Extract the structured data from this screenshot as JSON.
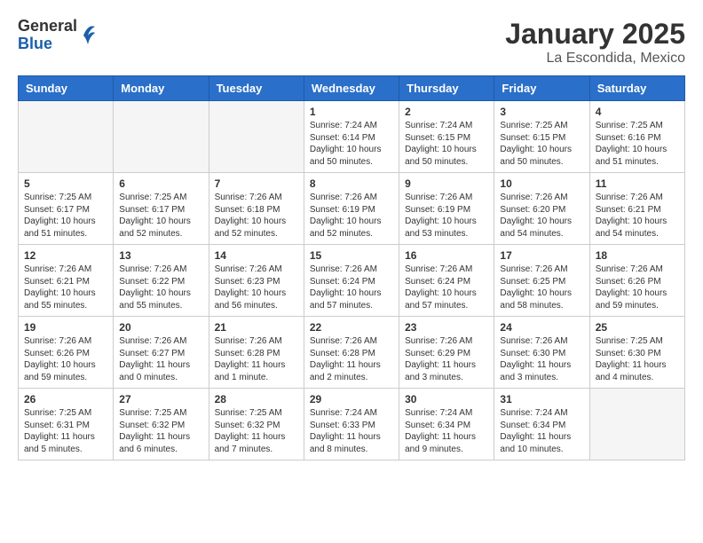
{
  "header": {
    "logo": {
      "general": "General",
      "blue": "Blue"
    },
    "title": "January 2025",
    "subtitle": "La Escondida, Mexico"
  },
  "weekdays": [
    "Sunday",
    "Monday",
    "Tuesday",
    "Wednesday",
    "Thursday",
    "Friday",
    "Saturday"
  ],
  "weeks": [
    {
      "days": [
        {
          "num": "",
          "info": ""
        },
        {
          "num": "",
          "info": ""
        },
        {
          "num": "",
          "info": ""
        },
        {
          "num": "1",
          "info": "Sunrise: 7:24 AM\nSunset: 6:14 PM\nDaylight: 10 hours\nand 50 minutes."
        },
        {
          "num": "2",
          "info": "Sunrise: 7:24 AM\nSunset: 6:15 PM\nDaylight: 10 hours\nand 50 minutes."
        },
        {
          "num": "3",
          "info": "Sunrise: 7:25 AM\nSunset: 6:15 PM\nDaylight: 10 hours\nand 50 minutes."
        },
        {
          "num": "4",
          "info": "Sunrise: 7:25 AM\nSunset: 6:16 PM\nDaylight: 10 hours\nand 51 minutes."
        }
      ]
    },
    {
      "days": [
        {
          "num": "5",
          "info": "Sunrise: 7:25 AM\nSunset: 6:17 PM\nDaylight: 10 hours\nand 51 minutes."
        },
        {
          "num": "6",
          "info": "Sunrise: 7:25 AM\nSunset: 6:17 PM\nDaylight: 10 hours\nand 52 minutes."
        },
        {
          "num": "7",
          "info": "Sunrise: 7:26 AM\nSunset: 6:18 PM\nDaylight: 10 hours\nand 52 minutes."
        },
        {
          "num": "8",
          "info": "Sunrise: 7:26 AM\nSunset: 6:19 PM\nDaylight: 10 hours\nand 52 minutes."
        },
        {
          "num": "9",
          "info": "Sunrise: 7:26 AM\nSunset: 6:19 PM\nDaylight: 10 hours\nand 53 minutes."
        },
        {
          "num": "10",
          "info": "Sunrise: 7:26 AM\nSunset: 6:20 PM\nDaylight: 10 hours\nand 54 minutes."
        },
        {
          "num": "11",
          "info": "Sunrise: 7:26 AM\nSunset: 6:21 PM\nDaylight: 10 hours\nand 54 minutes."
        }
      ]
    },
    {
      "days": [
        {
          "num": "12",
          "info": "Sunrise: 7:26 AM\nSunset: 6:21 PM\nDaylight: 10 hours\nand 55 minutes."
        },
        {
          "num": "13",
          "info": "Sunrise: 7:26 AM\nSunset: 6:22 PM\nDaylight: 10 hours\nand 55 minutes."
        },
        {
          "num": "14",
          "info": "Sunrise: 7:26 AM\nSunset: 6:23 PM\nDaylight: 10 hours\nand 56 minutes."
        },
        {
          "num": "15",
          "info": "Sunrise: 7:26 AM\nSunset: 6:24 PM\nDaylight: 10 hours\nand 57 minutes."
        },
        {
          "num": "16",
          "info": "Sunrise: 7:26 AM\nSunset: 6:24 PM\nDaylight: 10 hours\nand 57 minutes."
        },
        {
          "num": "17",
          "info": "Sunrise: 7:26 AM\nSunset: 6:25 PM\nDaylight: 10 hours\nand 58 minutes."
        },
        {
          "num": "18",
          "info": "Sunrise: 7:26 AM\nSunset: 6:26 PM\nDaylight: 10 hours\nand 59 minutes."
        }
      ]
    },
    {
      "days": [
        {
          "num": "19",
          "info": "Sunrise: 7:26 AM\nSunset: 6:26 PM\nDaylight: 10 hours\nand 59 minutes."
        },
        {
          "num": "20",
          "info": "Sunrise: 7:26 AM\nSunset: 6:27 PM\nDaylight: 11 hours\nand 0 minutes."
        },
        {
          "num": "21",
          "info": "Sunrise: 7:26 AM\nSunset: 6:28 PM\nDaylight: 11 hours\nand 1 minute."
        },
        {
          "num": "22",
          "info": "Sunrise: 7:26 AM\nSunset: 6:28 PM\nDaylight: 11 hours\nand 2 minutes."
        },
        {
          "num": "23",
          "info": "Sunrise: 7:26 AM\nSunset: 6:29 PM\nDaylight: 11 hours\nand 3 minutes."
        },
        {
          "num": "24",
          "info": "Sunrise: 7:26 AM\nSunset: 6:30 PM\nDaylight: 11 hours\nand 3 minutes."
        },
        {
          "num": "25",
          "info": "Sunrise: 7:25 AM\nSunset: 6:30 PM\nDaylight: 11 hours\nand 4 minutes."
        }
      ]
    },
    {
      "days": [
        {
          "num": "26",
          "info": "Sunrise: 7:25 AM\nSunset: 6:31 PM\nDaylight: 11 hours\nand 5 minutes."
        },
        {
          "num": "27",
          "info": "Sunrise: 7:25 AM\nSunset: 6:32 PM\nDaylight: 11 hours\nand 6 minutes."
        },
        {
          "num": "28",
          "info": "Sunrise: 7:25 AM\nSunset: 6:32 PM\nDaylight: 11 hours\nand 7 minutes."
        },
        {
          "num": "29",
          "info": "Sunrise: 7:24 AM\nSunset: 6:33 PM\nDaylight: 11 hours\nand 8 minutes."
        },
        {
          "num": "30",
          "info": "Sunrise: 7:24 AM\nSunset: 6:34 PM\nDaylight: 11 hours\nand 9 minutes."
        },
        {
          "num": "31",
          "info": "Sunrise: 7:24 AM\nSunset: 6:34 PM\nDaylight: 11 hours\nand 10 minutes."
        },
        {
          "num": "",
          "info": ""
        }
      ]
    }
  ]
}
